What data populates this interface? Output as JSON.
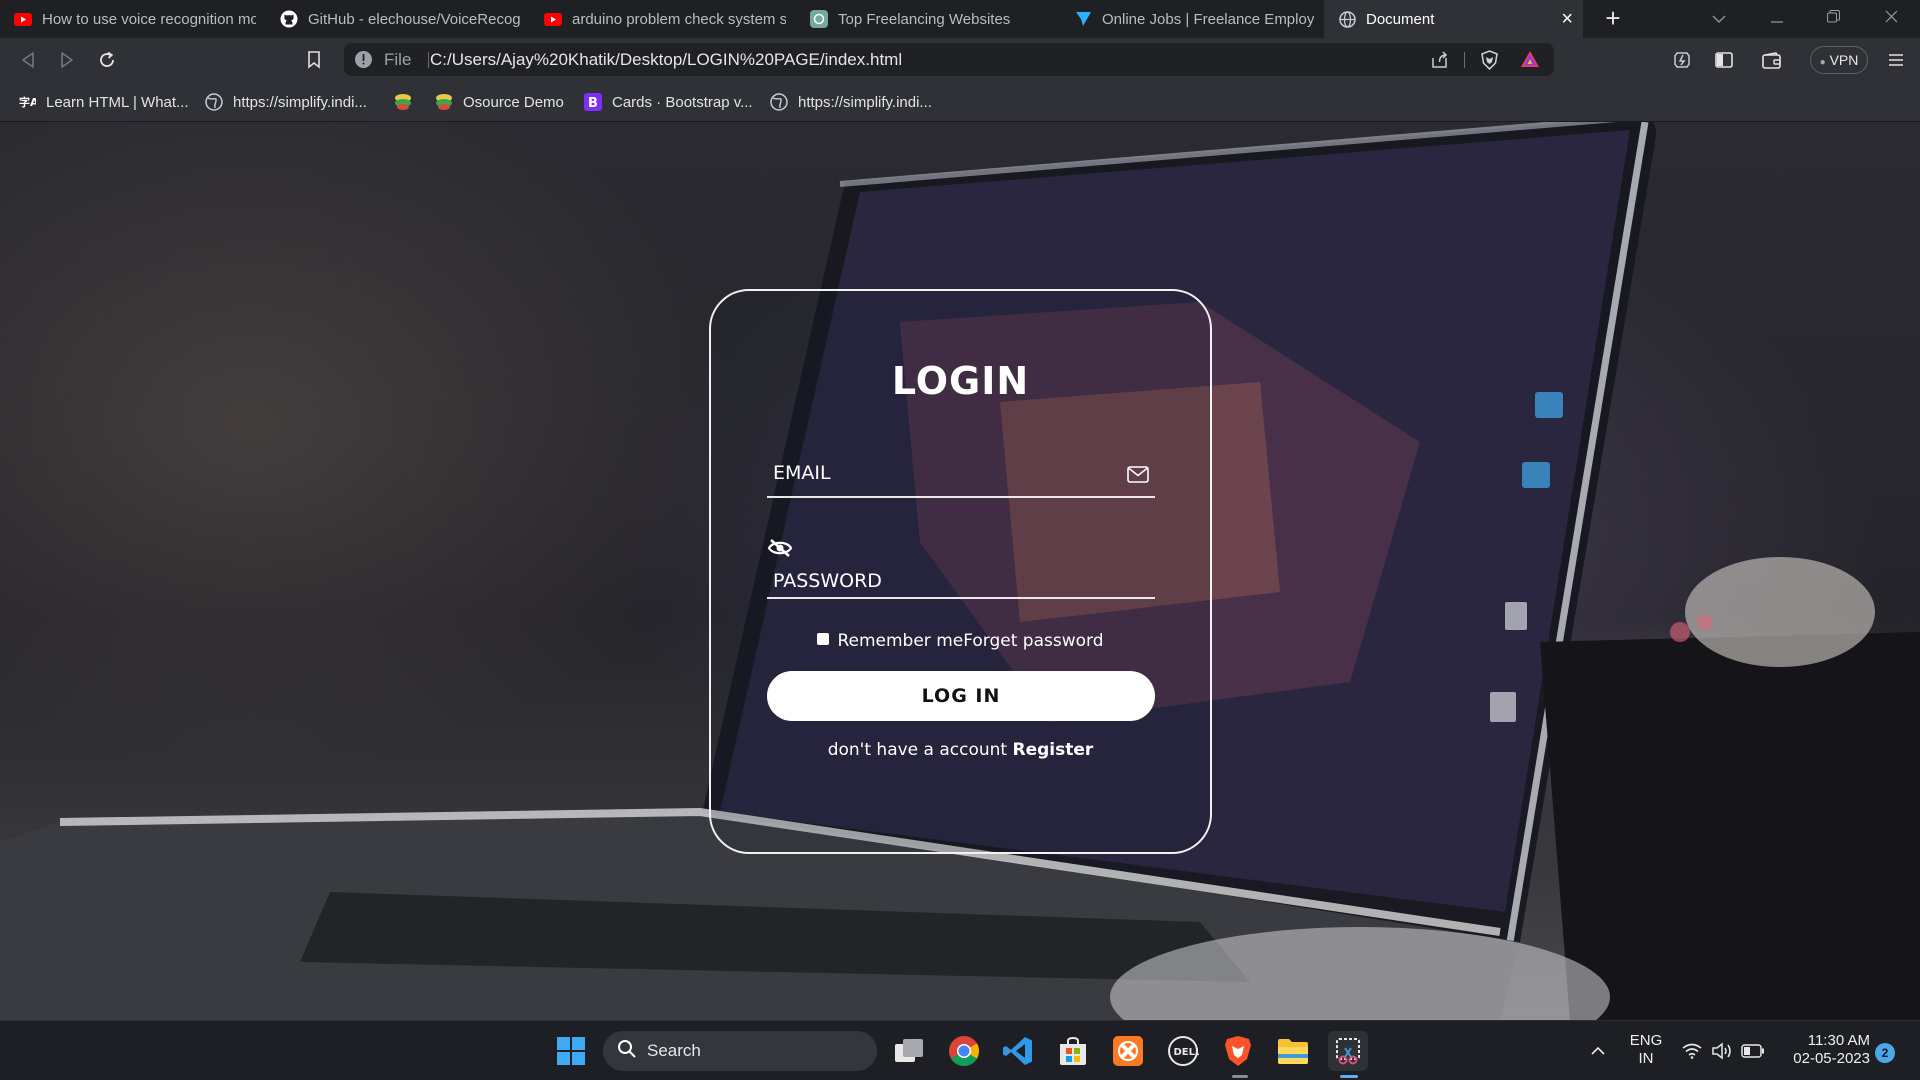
{
  "browser": {
    "tabs": [
      {
        "label": "How to use voice recognition mo",
        "icon": "youtube-icon"
      },
      {
        "label": "GitHub - elechouse/VoiceRecogn",
        "icon": "github-icon"
      },
      {
        "label": "arduino problem check system sc",
        "icon": "youtube-icon"
      },
      {
        "label": "Top Freelancing Websites",
        "icon": "chatgpt-icon"
      },
      {
        "label": "Online Jobs | Freelance Employm",
        "icon": "freelancer-icon"
      },
      {
        "label": "Document",
        "icon": "globe-icon"
      }
    ],
    "active_tab_close": "×",
    "new_tab": "+",
    "address": {
      "scheme_label": "File",
      "url": "C:/Users/Ajay%20Khatik/Desktop/LOGIN%20PAGE/index.html"
    },
    "vpn_label": "VPN",
    "bookmarks": [
      {
        "label": "Learn HTML | What...",
        "icon": "bookmark-site-icon"
      },
      {
        "label": "https://simplify.indi...",
        "icon": "globe-icon"
      },
      {
        "label": "",
        "icon": "osource-icon"
      },
      {
        "label": "Osource Demo",
        "icon": "osource-icon"
      },
      {
        "label": "Cards · Bootstrap v...",
        "icon": "bootstrap-icon"
      },
      {
        "label": "https://simplify.indi...",
        "icon": "globe-icon"
      }
    ]
  },
  "page": {
    "heading": "LOGIN",
    "email_label": "EMAIL",
    "password_label": "PASSWORD",
    "remember_text": "Remember meForget password",
    "login_button": "LOG IN",
    "register_prefix": "don't have a account ",
    "register_link": "Register"
  },
  "taskbar": {
    "search_label": "Search",
    "lang_line1": "ENG",
    "lang_line2": "IN",
    "time": "11:30 AM",
    "date": "02-05-2023",
    "notification_count": "2"
  },
  "colors": {
    "tabbar_bg": "#1f2024",
    "toolbar_bg": "#2f3136",
    "card_border": "#f2f2f2",
    "button_bg": "#ffffff",
    "taskbar_bg": "#1d1f24",
    "brave_orange": "#fb542b",
    "vscode_blue": "#2f9be8"
  }
}
